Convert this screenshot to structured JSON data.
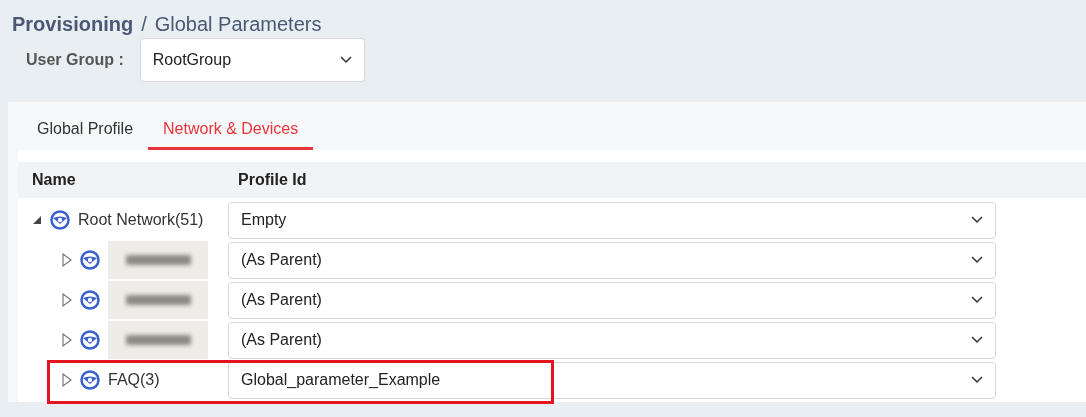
{
  "breadcrumb": {
    "items": [
      {
        "label": "Provisioning",
        "current": false
      },
      {
        "label": "Global Parameters",
        "current": true
      }
    ],
    "separator": "/"
  },
  "user_group": {
    "label": "User Group :",
    "value": "RootGroup"
  },
  "tabs": [
    {
      "label": "Global Profile",
      "selected": false
    },
    {
      "label": "Network & Devices",
      "selected": true
    }
  ],
  "table": {
    "columns": [
      "Name",
      "Profile Id"
    ],
    "tree": [
      {
        "kind": "named",
        "label": "Root Network(51)",
        "expanded": true,
        "highlighted": false,
        "profile": "Empty",
        "children": [
          {
            "kind": "redacted",
            "expanded": false,
            "highlighted": false,
            "profile": "(As Parent)"
          },
          {
            "kind": "redacted",
            "expanded": false,
            "highlighted": false,
            "profile": "(As Parent)"
          },
          {
            "kind": "redacted",
            "expanded": false,
            "highlighted": false,
            "profile": "(As Parent)"
          },
          {
            "kind": "named",
            "label": "FAQ(3)",
            "expanded": false,
            "highlighted": true,
            "profile": "Global_parameter_Example"
          }
        ]
      }
    ]
  }
}
